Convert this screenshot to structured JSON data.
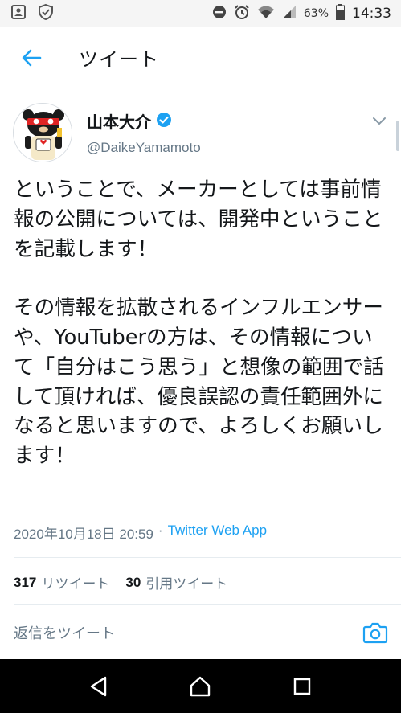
{
  "status_bar": {
    "battery_percent": "63%",
    "time": "14:33",
    "icons": [
      "contact-card-icon",
      "shield-check-icon",
      "do-not-disturb-icon",
      "alarm-icon",
      "wifi-icon",
      "signal-icon",
      "battery-icon"
    ]
  },
  "header": {
    "title": "ツイート",
    "back_icon": "arrow-left-icon"
  },
  "author": {
    "display_name": "山本大介",
    "handle": "@DaikeYamamoto",
    "verified": true,
    "verified_icon": "verified-badge-icon",
    "menu_icon": "chevron-down-icon"
  },
  "tweet": {
    "paragraph1": "ということで、メーカーとしては事前情報の公開については、開発中ということを記載します！",
    "paragraph2": "その情報を拡散されるインフルエンサーや、YouTuberの方は、その情報について「自分はこう思う」と想像の範囲で話して頂ければ、優良誤認の責任範囲外になると思いますので、よろしくお願いします！"
  },
  "meta": {
    "timestamp": "2020年10月18日 20:59",
    "separator": "·",
    "source": "Twitter Web App"
  },
  "stats": {
    "retweets_count": "317",
    "retweets_label": "リツイート",
    "quotes_count": "30",
    "quotes_label": "引用ツイート"
  },
  "reply": {
    "placeholder": "返信をツイート",
    "camera_icon": "camera-icon"
  },
  "nav_bar": {
    "icons": [
      "back-triangle-icon",
      "home-circle-icon",
      "recents-square-icon"
    ]
  },
  "colors": {
    "accent": "#1da1f2",
    "text": "#14171a",
    "secondary": "#657786",
    "divider": "#e6ecf0"
  }
}
